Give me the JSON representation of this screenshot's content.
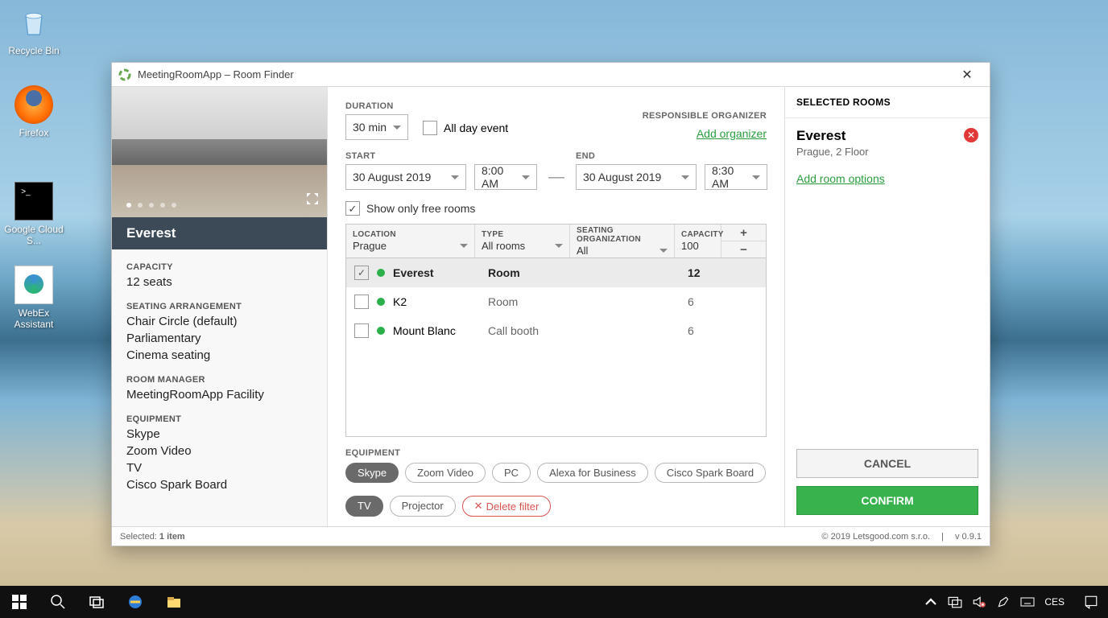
{
  "desktop": {
    "recycle_bin": "Recycle Bin",
    "firefox": "Firefox",
    "gcloud": "Google Cloud S...",
    "webex": "WebEx Assistant"
  },
  "taskbar": {
    "lang": "CES"
  },
  "window": {
    "title": "MeetingRoomApp – Room Finder",
    "footer_selected": "Selected: ",
    "footer_selected_count": "1 item",
    "footer_copyright": "© 2019 Letsgood.com s.r.o.",
    "footer_version": "v 0.9.1"
  },
  "room": {
    "name": "Everest",
    "capacity_label": "CAPACITY",
    "capacity_value": "12 seats",
    "seating_label": "SEATING ARRANGEMENT",
    "seating_values": [
      "Chair Circle (default)",
      "Parliamentary",
      "Cinema seating"
    ],
    "manager_label": "ROOM MANAGER",
    "manager_value": "MeetingRoomApp Facility",
    "equipment_label": "EQUIPMENT",
    "equipment_values": [
      "Skype",
      "Zoom Video",
      "TV",
      "Cisco Spark Board"
    ]
  },
  "form": {
    "duration_label": "DURATION",
    "duration_value": "30 min",
    "allday_label": "All day event",
    "responsible_label": "RESPONSIBLE ORGANIZER",
    "add_organizer": "Add organizer",
    "start_label": "START",
    "start_date": "30 August 2019",
    "start_time": "8:00 AM",
    "end_label": "END",
    "end_date": "30 August 2019",
    "end_time": "8:30 AM",
    "showfree": "Show only free rooms"
  },
  "table": {
    "headers": {
      "location": "LOCATION",
      "type": "TYPE",
      "seating": "SEATING ORGANIZATION",
      "capacity": "CAPACITY"
    },
    "filters": {
      "location": "Prague",
      "type": "All rooms",
      "seating": "All",
      "capacity": "100"
    },
    "rows": [
      {
        "name": "Everest",
        "type": "Room",
        "capacity": "12",
        "selected": true
      },
      {
        "name": "K2",
        "type": "Room",
        "capacity": "6",
        "selected": false
      },
      {
        "name": "Mount Blanc",
        "type": "Call booth",
        "capacity": "6",
        "selected": false
      }
    ]
  },
  "equipment": {
    "label": "EQUIPMENT",
    "chips": [
      {
        "label": "Skype",
        "active": true
      },
      {
        "label": "Zoom Video",
        "active": false
      },
      {
        "label": "PC",
        "active": false
      },
      {
        "label": "Alexa for Business",
        "active": false
      },
      {
        "label": "Cisco Spark Board",
        "active": false
      },
      {
        "label": "TV",
        "active": true
      },
      {
        "label": "Projector",
        "active": false
      }
    ],
    "delete_label": "Delete filter"
  },
  "selected": {
    "header": "SELECTED ROOMS",
    "rooms": [
      {
        "name": "Everest",
        "location": "Prague, 2 Floor"
      }
    ],
    "add_options": "Add room options",
    "cancel": "CANCEL",
    "confirm": "CONFIRM"
  }
}
